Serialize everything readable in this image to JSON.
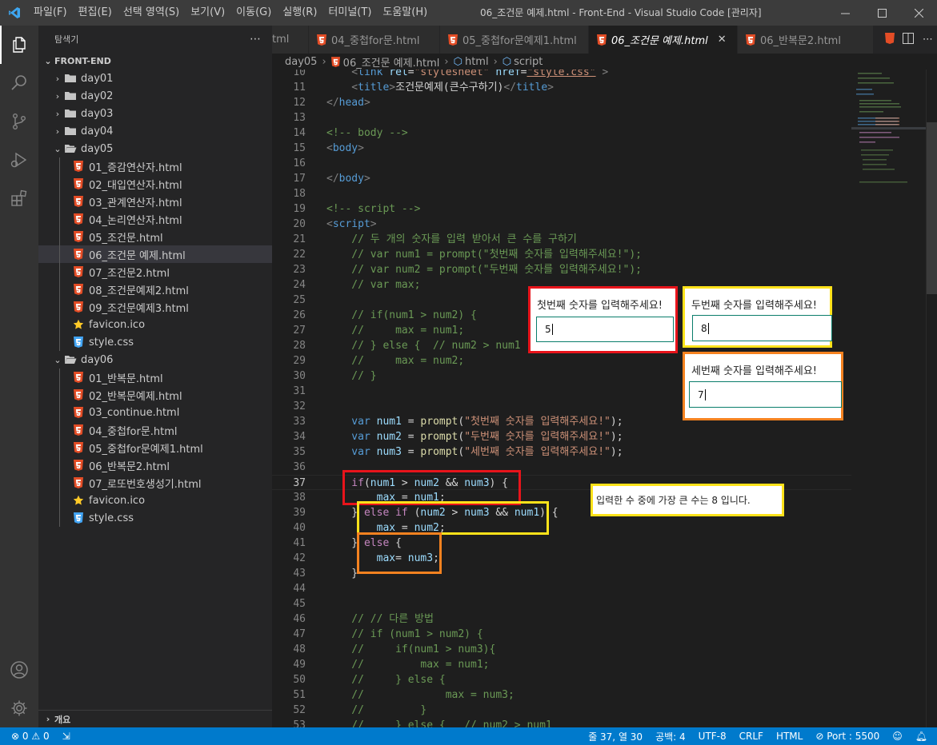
{
  "window": {
    "title": "06_조건문 예제.html - Front-End - Visual Studio Code [관리자]"
  },
  "menu": [
    "파일(F)",
    "편집(E)",
    "선택 영역(S)",
    "보기(V)",
    "이동(G)",
    "실행(R)",
    "터미널(T)",
    "도움말(H)"
  ],
  "sidebar": {
    "title": "탐색기",
    "root": "FRONT-END",
    "folders": [
      "day01",
      "day02",
      "day03",
      "day04"
    ],
    "day05": {
      "name": "day05",
      "files": [
        "01_증감연산자.html",
        "02_대입연산자.html",
        "03_관계연산자.html",
        "04_논리연산자.html",
        "05_조건문.html",
        "06_조건문 예제.html",
        "07_조건문2.html",
        "08_조건문예제2.html",
        "09_조건문예제3.html",
        "favicon.ico",
        "style.css"
      ]
    },
    "day06": {
      "name": "day06",
      "files": [
        "01_반복문.html",
        "02_반복문예제.html",
        "03_continue.html",
        "04_중첩for문.html",
        "05_중첩for문예제1.html",
        "06_반복문2.html",
        "07_로또번호생성기.html",
        "favicon.ico",
        "style.css"
      ]
    },
    "outline": "개요"
  },
  "tabs": [
    "tml",
    "04_중첩for문.html",
    "05_중첩for문예제1.html",
    "06_조건문 예제.html",
    "06_반복문2.html"
  ],
  "breadcrumb": [
    "day05",
    "06_조건문 예제.html",
    "html",
    "script"
  ],
  "line_numbers": [
    "10",
    "11",
    "12",
    "13",
    "14",
    "15",
    "16",
    "17",
    "18",
    "19",
    "20",
    "21",
    "22",
    "23",
    "24",
    "25",
    "26",
    "27",
    "28",
    "29",
    "30",
    "31",
    "32",
    "33",
    "34",
    "35",
    "36",
    "37",
    "38",
    "39",
    "40",
    "41",
    "42",
    "43",
    "44",
    "45",
    "46",
    "47",
    "48",
    "49",
    "50",
    "51",
    "52",
    "53"
  ],
  "code": {
    "l10_open": "    <",
    "l10_tag": "link",
    "l10_a1": " rel",
    "l10_eq1": "=",
    "l10_v1": "\"stylesheet\"",
    "l10_a2": " href",
    "l10_eq2": "=",
    "l10_v2": "\"style.css\"",
    "l10_close": " >",
    "l11_open": "    <",
    "l11_tag": "title",
    "l11_gt": ">",
    "l11_text": "조건문예제(큰수구하기)",
    "l11_endopen": "</",
    "l11_endtag": "title",
    "l11_endgt": ">",
    "l12_open": "</",
    "l12_tag": "head",
    "l12_gt": ">",
    "l14": "<!-- body -->",
    "l15_open": "<",
    "l15_tag": "body",
    "l15_gt": ">",
    "l17_open": "</",
    "l17_tag": "body",
    "l17_gt": ">",
    "l19": "<!-- script -->",
    "l20_open": "<",
    "l20_tag": "script",
    "l20_gt": ">",
    "l21": "    // 두 개의 숫자를 입력 받아서 큰 수를 구하기",
    "l22": "    // var num1 = prompt(\"첫번째 숫자를 입력해주세요!\");",
    "l23": "    // var num2 = prompt(\"두번째 숫자를 입력해주세요!\");",
    "l24": "    // var max;",
    "l26": "    // if(num1 > num2) {",
    "l27": "    //     max = num1;",
    "l28": "    // } else {  // num2 > num1",
    "l29": "    //     max = num2;",
    "l30": "    // }",
    "l33_kw": "    var",
    "l33_id": " num1",
    "l33_eq": " = ",
    "l33_fn": "prompt",
    "l33_p": "(",
    "l33_str": "\"첫번째 숫자를 입력해주세요!\"",
    "l33_end": ");",
    "l34_kw": "    var",
    "l34_id": " num2",
    "l34_eq": " = ",
    "l34_fn": "prompt",
    "l34_p": "(",
    "l34_str": "\"두번째 숫자를 입력해주세요!\"",
    "l34_end": ");",
    "l35_kw": "    var",
    "l35_id": " num3",
    "l35_eq": " = ",
    "l35_fn": "prompt",
    "l35_p": "(",
    "l35_str": "\"세번째 숫자를 입력해주세요!\"",
    "l35_end": ");",
    "l37_kw": "    if",
    "l37_a": "(",
    "l37_id1": "num1",
    "l37_op1": " > ",
    "l37_id2": "num2",
    "l37_op2": " && ",
    "l37_id3": "num3",
    "l37_end": ") {",
    "l38_id1": "        max",
    "l38_eq": " = ",
    "l38_id2": "num1",
    "l38_end": ";",
    "l39_a": "    } ",
    "l39_kw": "else if",
    "l39_b": " (",
    "l39_id1": "num2",
    "l39_op1": " > ",
    "l39_id2": "num3",
    "l39_op2": " && ",
    "l39_id3": "num1",
    "l39_end": ") {",
    "l40_id1": "        max",
    "l40_eq": " = ",
    "l40_id2": "num2",
    "l40_end": ";",
    "l41_a": "    } ",
    "l41_kw": "else",
    "l41_end": " {",
    "l42_id1": "        max",
    "l42_eq": "= ",
    "l42_id2": "num3",
    "l42_end": ";",
    "l43": "    }",
    "l46": "    // // 다른 방법",
    "l47": "    // if (num1 > num2) {",
    "l48": "    //     if(num1 > num3){",
    "l49": "    //         max = num1;",
    "l50": "    //     } else {",
    "l51": "    //             max = num3;",
    "l52": "    //         }",
    "l53": "    //     } else {   // num2 > num1"
  },
  "dialogs": [
    {
      "label": "첫번째 숫자를 입력해주세요!",
      "value": "5"
    },
    {
      "label": "두번째 숫자를 입력해주세요!",
      "value": "8"
    },
    {
      "label": "세번째 숫자를 입력해주세요!",
      "value": "7"
    }
  ],
  "result_text": "입력한 수 중에 가장 큰 수는 8 입니다.",
  "status": {
    "problems": "0",
    "warnings": "0",
    "position": "줄 37, 열 30",
    "indent": "공백: 4",
    "encoding": "UTF-8",
    "eol": "CRLF",
    "language": "HTML",
    "port": "Port : 5500"
  },
  "colors": {
    "statusbar": "#007acc",
    "annot_red": "#e8141b",
    "annot_yellow": "#ffe21a",
    "annot_orange": "#f58220",
    "html_icon": "#e44d26",
    "css_icon": "#42a5f5",
    "favicon_icon": "#ffca28"
  }
}
